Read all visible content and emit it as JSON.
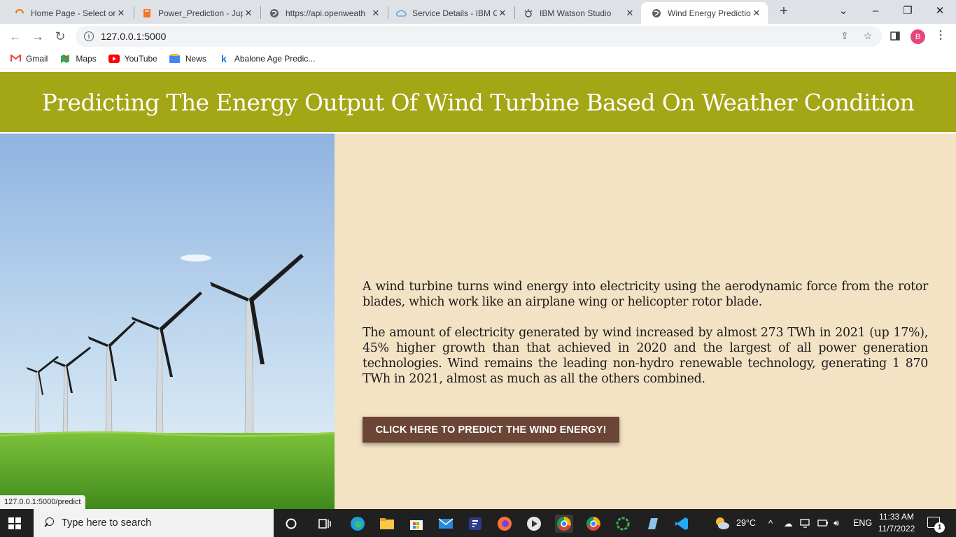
{
  "browser": {
    "tabs": [
      {
        "title": "Home Page - Select or",
        "icon": "spinner-icon"
      },
      {
        "title": "Power_Prediction - Jup",
        "icon": "jupyter-icon"
      },
      {
        "title": "https://api.openweath",
        "icon": "globe-icon"
      },
      {
        "title": "Service Details - IBM C",
        "icon": "cloud-icon"
      },
      {
        "title": "IBM Watson Studio",
        "icon": "watson-icon"
      },
      {
        "title": "Wind Energy Predictio",
        "icon": "globe-icon",
        "active": true
      }
    ],
    "address": "127.0.0.1:5000",
    "profile_initial": "B",
    "bookmarks": [
      "Gmail",
      "Maps",
      "YouTube",
      "News",
      "Abalone Age Predic..."
    ]
  },
  "page": {
    "title": "Predicting The Energy Output Of Wind Turbine Based On Weather Condition",
    "paragraph1": "A wind turbine turns wind energy into electricity using the aerodynamic force from the rotor blades, which work like an airplane wing or helicopter rotor blade.",
    "paragraph2": "The amount of electricity generated by wind increased by almost 273 TWh in 2021 (up 17%), 45% higher growth than that achieved in 2020 and the largest of all power generation technologies. Wind remains the leading non-hydro renewable technology, generating 1 870 TWh in 2021, almost as much as all the others combined.",
    "cta_label": "CLICK HERE TO PREDICT THE WIND ENERGY!",
    "status_url": "127.0.0.1:5000/predict",
    "colors": {
      "header": "#a3a615",
      "panel": "#f4e2c4",
      "button": "#6b4536"
    }
  },
  "taskbar": {
    "search_placeholder": "Type here to search",
    "weather": "29°C",
    "language": "ENG",
    "time": "11:33 AM",
    "date": "11/7/2022",
    "notifications": "1"
  }
}
